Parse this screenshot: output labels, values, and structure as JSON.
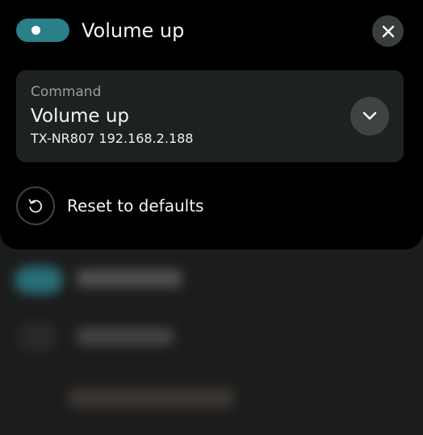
{
  "header": {
    "toggle_state": "on",
    "title": "Volume up",
    "close_icon": "close-icon"
  },
  "command_card": {
    "label": "Command",
    "value": "Volume up",
    "subtitle": "TX-NR807 192.168.2.188",
    "dropdown_icon": "chevron-down-icon"
  },
  "reset": {
    "icon": "reset-icon",
    "label": "Reset to defaults"
  },
  "colors": {
    "sheet_background": "#000000",
    "accent": "#2a7f89",
    "card_background": "#1e2122",
    "button_background": "#3e4344"
  }
}
